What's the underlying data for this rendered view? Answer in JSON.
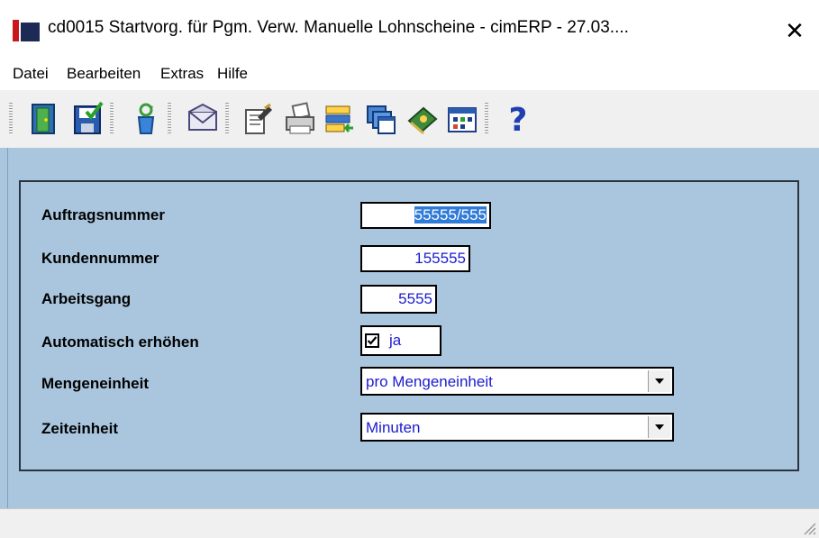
{
  "window": {
    "title": "cd0015 Startvorg. für Pgm. Verw. Manuelle Lohnscheine - cimERP - 27.03....",
    "close_label": "✕"
  },
  "menu": {
    "items": [
      "Datei",
      "Bearbeiten",
      "Extras",
      "Hilfe"
    ]
  },
  "toolbar": {
    "buttons": [
      "exit-door-icon",
      "save-disk-icon",
      "recycle-icon",
      "mail-envelope-icon",
      "edit-notes-icon",
      "printer-icon",
      "list-transfer-icon",
      "windows-stack-icon",
      "book-icon",
      "calendar-icon",
      "help-question-icon"
    ]
  },
  "form": {
    "auftragsnummer_label": "Auftragsnummer",
    "auftragsnummer_value": "55555/555",
    "kundennummer_label": "Kundennummer",
    "kundennummer_value": "155555",
    "arbeitsgang_label": "Arbeitsgang",
    "arbeitsgang_value": "5555",
    "automatisch_label": "Automatisch erhöhen",
    "automatisch_checked": true,
    "automatisch_value": "ja",
    "mengeneinheit_label": "Mengeneinheit",
    "mengeneinheit_value": "pro Mengeneinheit",
    "zeiteinheit_label": "Zeiteinheit",
    "zeiteinheit_value": "Minuten"
  },
  "colors": {
    "background": "#a9c6de",
    "field_text": "#1b1bd0",
    "selection": "#2f7bd8"
  }
}
